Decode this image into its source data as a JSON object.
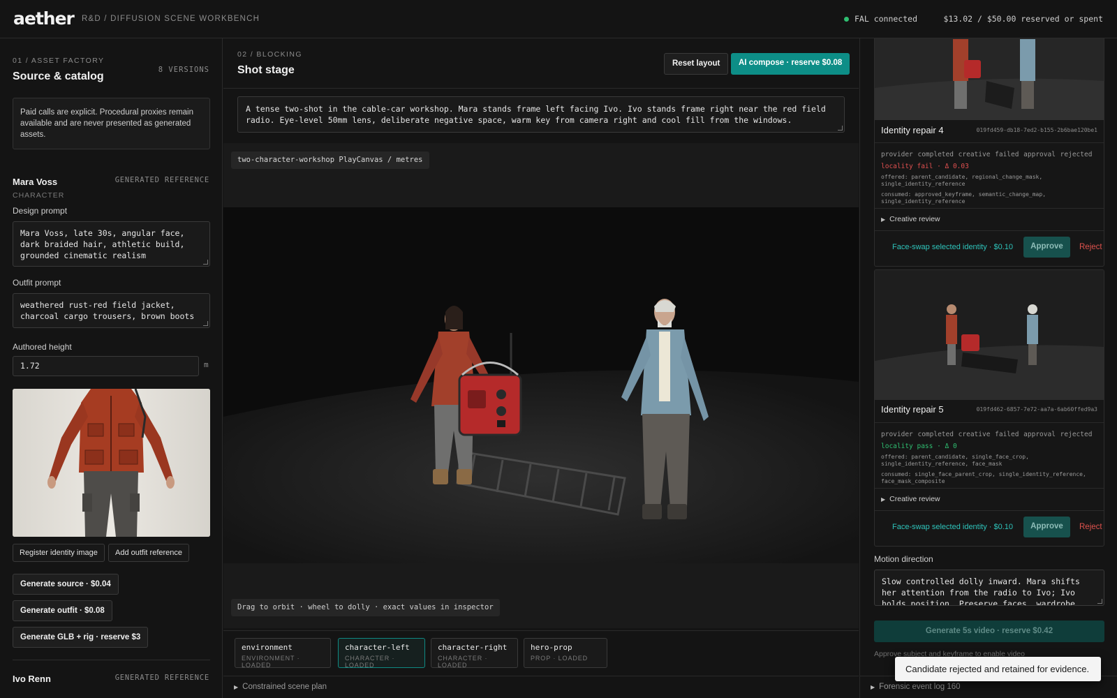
{
  "header": {
    "logo": "aether",
    "breadcrumb": "R&D / DIFFUSION SCENE WORKBENCH",
    "connection_status": "FAL connected",
    "budget": "$13.02 / $50.00 reserved or spent",
    "status_color": "#2fbf71"
  },
  "left": {
    "section_number": "01 / ASSET FACTORY",
    "section_title": "Source & catalog",
    "versions": "8 VERSIONS",
    "notice": "Paid calls are explicit. Procedural proxies remain available and are never presented as generated assets.",
    "character": {
      "name": "Mara Voss",
      "type": "CHARACTER",
      "reference_badge": "GENERATED REFERENCE",
      "design_label": "Design prompt",
      "design_prompt": "Mara Voss, late 30s, angular face, dark braided hair, athletic build, grounded cinematic realism",
      "outfit_label": "Outfit prompt",
      "outfit_prompt": "weathered rust-red field jacket, charcoal cargo trousers, brown boots",
      "height_label": "Authored height",
      "height_value": "1.72",
      "height_unit": "m"
    },
    "buttons": {
      "register_identity": "Register identity image",
      "add_outfit": "Add outfit reference",
      "generate_source": "Generate source · $0.04",
      "generate_outfit": "Generate outfit · $0.08",
      "generate_glb": "Generate GLB + rig · reserve $3"
    },
    "next_character": {
      "name": "Ivo Renn",
      "reference_badge": "GENERATED REFERENCE"
    }
  },
  "stage": {
    "section_number": "02 / BLOCKING",
    "title": "Shot stage",
    "reset_label": "Reset layout",
    "compose_label": "AI compose · reserve $0.08",
    "accent": "#0d8e87",
    "scene_prompt": "A tense two-shot in the cable-car workshop. Mara stands frame left facing Ivo. Ivo stands frame right near the red field radio. Eye-level 50mm lens, deliberate negative space, warm key from camera right and cool fill from the windows.",
    "scene_tag": "two-character-workshop  PlayCanvas / metres",
    "orbit_hint": "Drag to orbit · wheel to dolly · exact values in inspector",
    "assets": [
      {
        "name": "environment",
        "meta": "ENVIRONMENT · LOADED"
      },
      {
        "name": "character-left",
        "meta": "CHARACTER · LOADED"
      },
      {
        "name": "character-right",
        "meta": "CHARACTER · LOADED"
      },
      {
        "name": "hero-prop",
        "meta": "PROP · LOADED"
      }
    ],
    "plan_label": "Constrained scene plan"
  },
  "review": {
    "cards": [
      {
        "title": "Identity repair 4",
        "id": "019fd459-db18-7ed2-b155-2b6bae120be1",
        "status": "provider completed  creative failed  approval rejected",
        "locality": "locality fail · Δ 0.03",
        "offered": "offered: parent_candidate, regional_change_mask, single_identity_reference",
        "consumed": "consumed: approved_keyframe, semantic_change_map, single_identity_reference",
        "review_label": "Creative review",
        "swap_label": "Face-swap selected identity · $0.10",
        "approve_label": "Approve",
        "reject_label": "Reject"
      },
      {
        "title": "Identity repair 5",
        "id": "019fd462-6857-7e72-aa7a-6ab60ffed9a3",
        "status": "provider completed  creative failed  approval rejected",
        "locality": "locality pass · Δ 0",
        "offered": "offered: parent_candidate, single_face_crop, single_identity_reference, face_mask",
        "consumed": "consumed: single_face_parent_crop, single_identity_reference, face_mask_composite",
        "review_label": "Creative review",
        "swap_label": "Face-swap selected identity · $0.10",
        "approve_label": "Approve",
        "reject_label": "Reject"
      }
    ],
    "motion_label": "Motion direction",
    "motion_prompt": "Slow controlled dolly inward. Mara shifts her attention from the radio to Ivo; Ivo holds position. Preserve faces, wardrobe, blocking",
    "video_label": "Generate 5s video · reserve $0.42",
    "video_hint": "Approve subject and keyframe to enable video",
    "log_label": "Forensic event log 160"
  },
  "toast": "Candidate rejected and retained for evidence."
}
